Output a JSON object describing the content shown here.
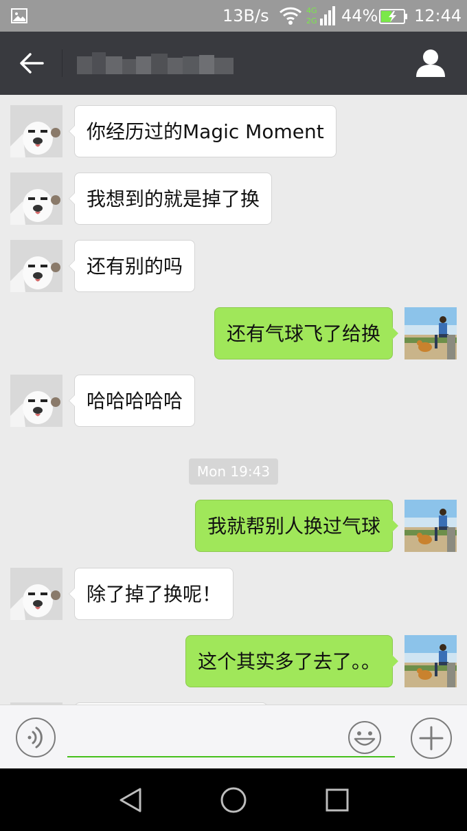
{
  "status_bar": {
    "network_speed": "13B/s",
    "signal_labels": [
      "4G",
      "2G"
    ],
    "battery_percent": "44%",
    "time": "12:44"
  },
  "header": {
    "title": "",
    "back_icon": "arrow-left-icon",
    "profile_icon": "person-icon"
  },
  "chat": {
    "timestamp": "Mon 19:43",
    "messages": [
      {
        "side": "in",
        "text": "你经历过的Magic Moment"
      },
      {
        "side": "in",
        "text": "我想到的就是掉了换"
      },
      {
        "side": "in",
        "text": "还有别的吗"
      },
      {
        "side": "out",
        "text": "还有气球飞了给换"
      },
      {
        "side": "in",
        "text": "哈哈哈哈哈"
      },
      {
        "side": "out",
        "text": "我就帮别人换过气球"
      },
      {
        "side": "in",
        "text": "除了掉了换呢！"
      },
      {
        "side": "out",
        "text": "这个其实多了去了。。"
      }
    ]
  },
  "input_bar": {
    "value": "",
    "voice_icon": "voice-icon",
    "emoji_icon": "emoji-icon",
    "plus_icon": "plus-icon"
  },
  "nav_bar": {
    "icons": [
      "nav-back-icon",
      "nav-home-icon",
      "nav-recents-icon"
    ]
  },
  "colors": {
    "status_bar": "#9a9a9a",
    "header": "#393a3f",
    "chat_bg": "#ebebeb",
    "bubble_out": "#a0e75a",
    "bubble_in": "#ffffff",
    "input_underline": "#45c01a"
  }
}
